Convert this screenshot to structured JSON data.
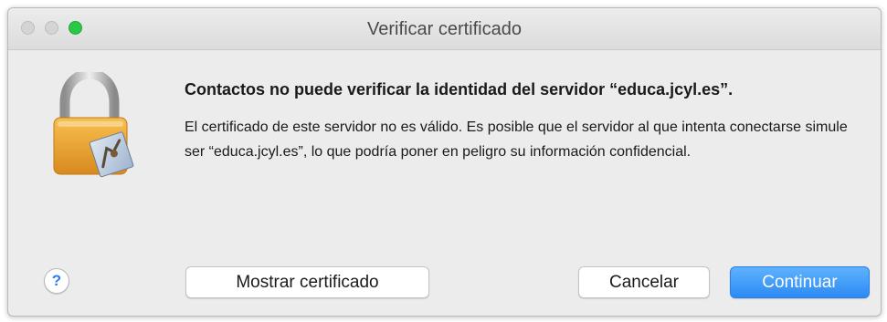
{
  "window": {
    "title": "Verificar certificado"
  },
  "dialog": {
    "heading": "Contactos no puede verificar la identidad del servidor “educa.jcyl.es”.",
    "message": "El certificado de este servidor no es válido. Es posible que el servidor al que intenta conectarse simule ser “educa.jcyl.es”, lo que podría poner en peligro su información confidencial."
  },
  "buttons": {
    "help_label": "?",
    "show_certificate": "Mostrar certificado",
    "cancel": "Cancelar",
    "continue": "Continuar"
  },
  "icons": {
    "dialog_icon": "padlock-certificate-icon",
    "close": "close-icon",
    "minimize": "minimize-icon",
    "maximize": "maximize-icon"
  },
  "colors": {
    "accent": "#2b8bf5",
    "maximize_green": "#2ac845",
    "lock_gold": "#e9a23b"
  }
}
